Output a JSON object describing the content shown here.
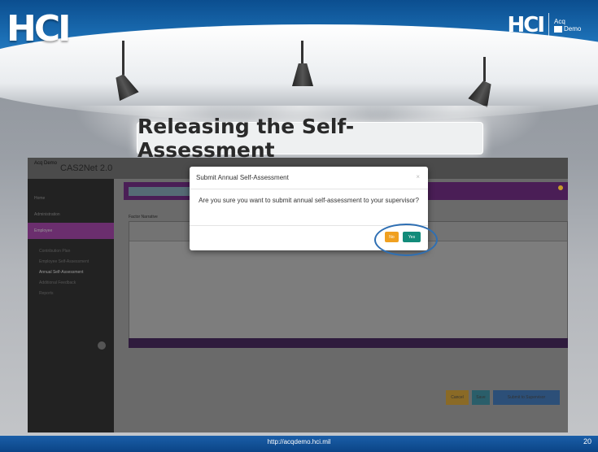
{
  "slide": {
    "logo_left": "HCI",
    "logo_right": "HCI",
    "acq_logo_line1": "Acq",
    "acq_logo_line2": "Demo",
    "title": "Releasing the Self-Assessment",
    "url": "http://acqdemo.hci.mil",
    "page_number": "20"
  },
  "app": {
    "name": "CAS2Net 2.0",
    "logo_text": "Acq Demo",
    "sidebar": {
      "items": [
        "Home",
        "Administration",
        "Employee"
      ],
      "subitems": [
        "Contribution Plan",
        "Employee Self-Assessment",
        "Annual Self-Assessment",
        "Additional Feedback",
        "Reports"
      ],
      "active_item": "Employee",
      "highlighted_subitem": "Annual Self-Assessment"
    },
    "editor": {
      "label": "Factor Narrative"
    },
    "buttons": {
      "cancel": "Cancel",
      "save": "Save",
      "submit": "Submit to Supervisor"
    }
  },
  "modal": {
    "title": "Submit Annual Self-Assessment",
    "close": "×",
    "message": "Are you sure you want to submit annual self-assessment to your supervisor?",
    "no_label": "No",
    "yes_label": "Yes",
    "colors": {
      "no": "#f0a020",
      "yes": "#128b7a",
      "highlight_circle": "#2e6fb3"
    }
  }
}
